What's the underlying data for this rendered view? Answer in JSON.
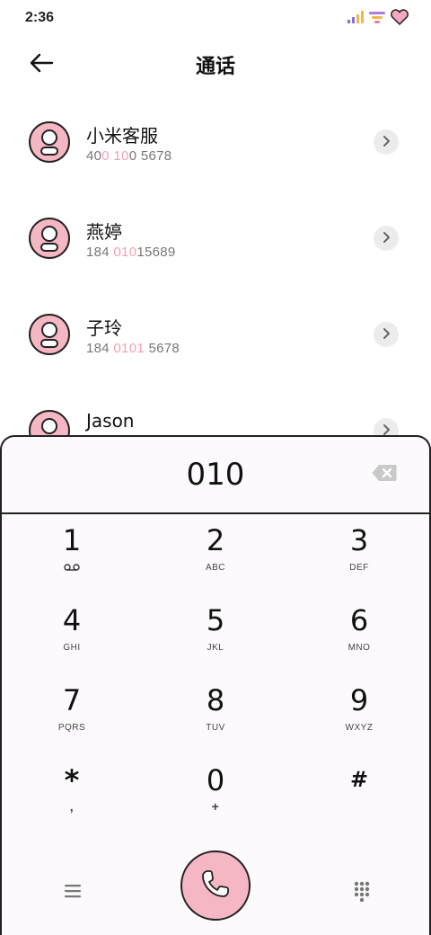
{
  "status_bar": {
    "time": "2:36"
  },
  "header": {
    "title": "通话"
  },
  "contacts": [
    {
      "name": "小米客服",
      "number_parts": [
        "40",
        "0 10",
        "0 5678"
      ]
    },
    {
      "name": "燕婷",
      "number_parts": [
        "184 ",
        "010",
        "15689"
      ]
    },
    {
      "name": "子玲",
      "number_parts": [
        "184 ",
        "0101",
        " 5678"
      ]
    },
    {
      "name": "Jason",
      "number_parts": [
        "",
        "",
        ""
      ]
    }
  ],
  "dialer": {
    "entered_number": "010",
    "keys": [
      {
        "digit": "1",
        "letters": "",
        "icon": "voicemail-icon"
      },
      {
        "digit": "2",
        "letters": "ABC"
      },
      {
        "digit": "3",
        "letters": "DEF"
      },
      {
        "digit": "4",
        "letters": "GHI"
      },
      {
        "digit": "5",
        "letters": "JKL"
      },
      {
        "digit": "6",
        "letters": "MNO"
      },
      {
        "digit": "7",
        "letters": "PQRS"
      },
      {
        "digit": "8",
        "letters": "TUV"
      },
      {
        "digit": "9",
        "letters": "WXYZ"
      },
      {
        "digit": "*",
        "letters": ","
      },
      {
        "digit": "0",
        "letters": "+"
      },
      {
        "digit": "#",
        "letters": ""
      }
    ]
  },
  "colors": {
    "accent_pink": "#f6b7c5",
    "highlight_pink": "#f2a3b6",
    "outline": "#222222"
  }
}
